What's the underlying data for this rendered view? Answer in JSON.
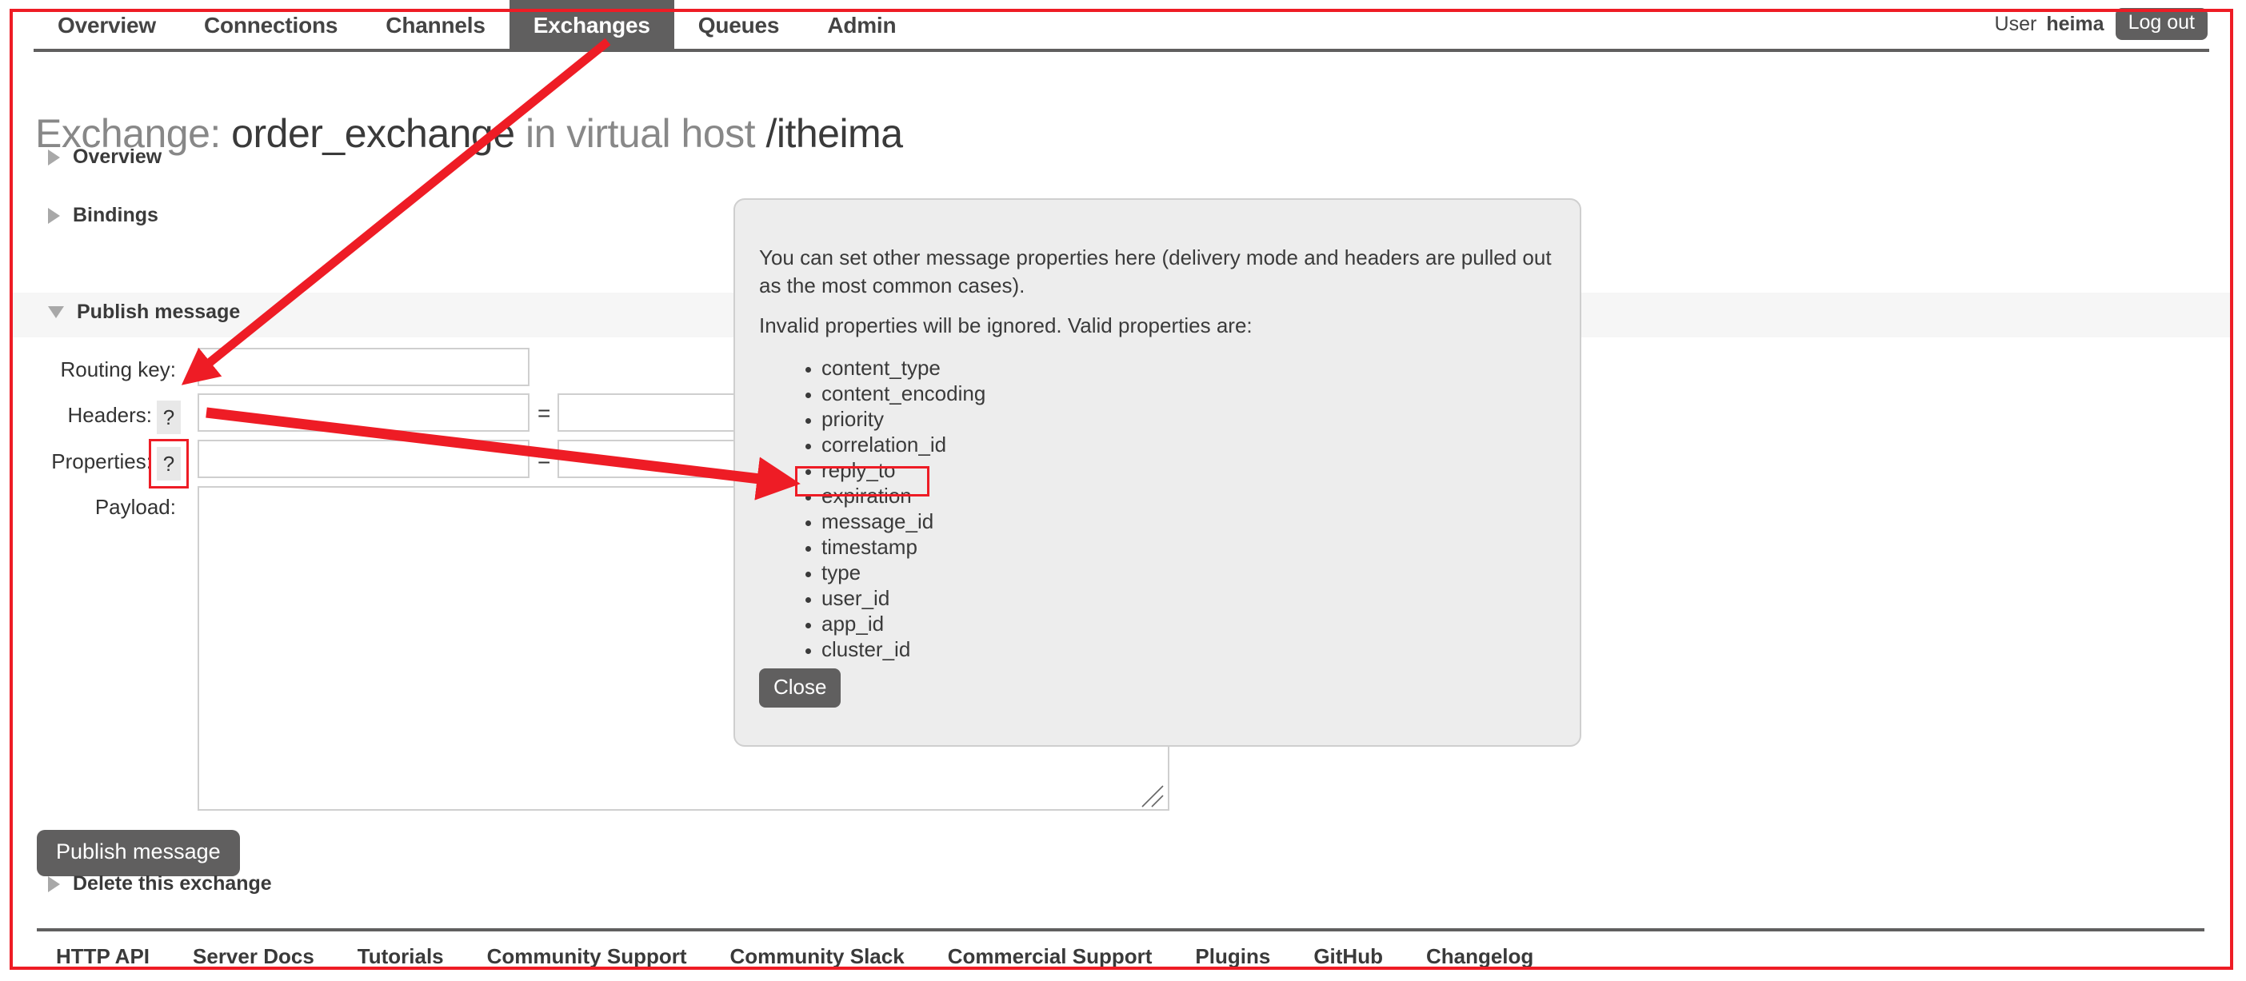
{
  "nav": {
    "tabs": [
      {
        "label": "Overview",
        "selected": false
      },
      {
        "label": "Connections",
        "selected": false
      },
      {
        "label": "Channels",
        "selected": false
      },
      {
        "label": "Exchanges",
        "selected": true
      },
      {
        "label": "Queues",
        "selected": false
      },
      {
        "label": "Admin",
        "selected": false
      }
    ],
    "user_word": "User",
    "user_name": "heima",
    "logout_label": "Log out"
  },
  "page": {
    "title_prefix": "Exchange: ",
    "exchange_name": "order_exchange",
    "title_middle": " in virtual host ",
    "vhost": "/itheima",
    "sections": {
      "overview": "Overview",
      "bindings": "Bindings",
      "publish_message": "Publish message",
      "delete_exchange": "Delete this exchange"
    }
  },
  "publish_form": {
    "routing_key_label": "Routing key:",
    "routing_key_value": "",
    "headers_label": "Headers:",
    "headers_help": "?",
    "header_key_value": "",
    "header_value_value": "",
    "properties_label": "Properties:",
    "properties_help": "?",
    "property_key_value": "",
    "property_value_value": "",
    "equals_sign": "=",
    "payload_label": "Payload:",
    "payload_value": "",
    "publish_button_label": "Publish message"
  },
  "help_popup": {
    "intro": "You can set other message properties here (delivery mode and headers are pulled out as the most common cases).",
    "invalid_note": "Invalid properties will be ignored. Valid properties are:",
    "properties": [
      "content_type",
      "content_encoding",
      "priority",
      "correlation_id",
      "reply_to",
      "expiration",
      "message_id",
      "timestamp",
      "type",
      "user_id",
      "app_id",
      "cluster_id"
    ],
    "highlighted_property": "expiration",
    "close_label": "Close"
  },
  "footer": {
    "links": [
      "HTTP API",
      "Server Docs",
      "Tutorials",
      "Community Support",
      "Community Slack",
      "Commercial Support",
      "Plugins",
      "GitHub",
      "Changelog"
    ]
  },
  "annotation": {
    "color": "#ee1c25",
    "frame": "page-outline",
    "arrows": [
      {
        "name": "arrow-exchanges-tab-to-properties-help",
        "from": "exchanges-tab",
        "to": "properties-help-button"
      },
      {
        "name": "arrow-properties-help-to-expiration",
        "from": "properties-help-button",
        "to": "expiration-list-item"
      }
    ],
    "highlights": [
      "exchanges-tab",
      "properties-help-button",
      "expiration-list-item"
    ]
  }
}
